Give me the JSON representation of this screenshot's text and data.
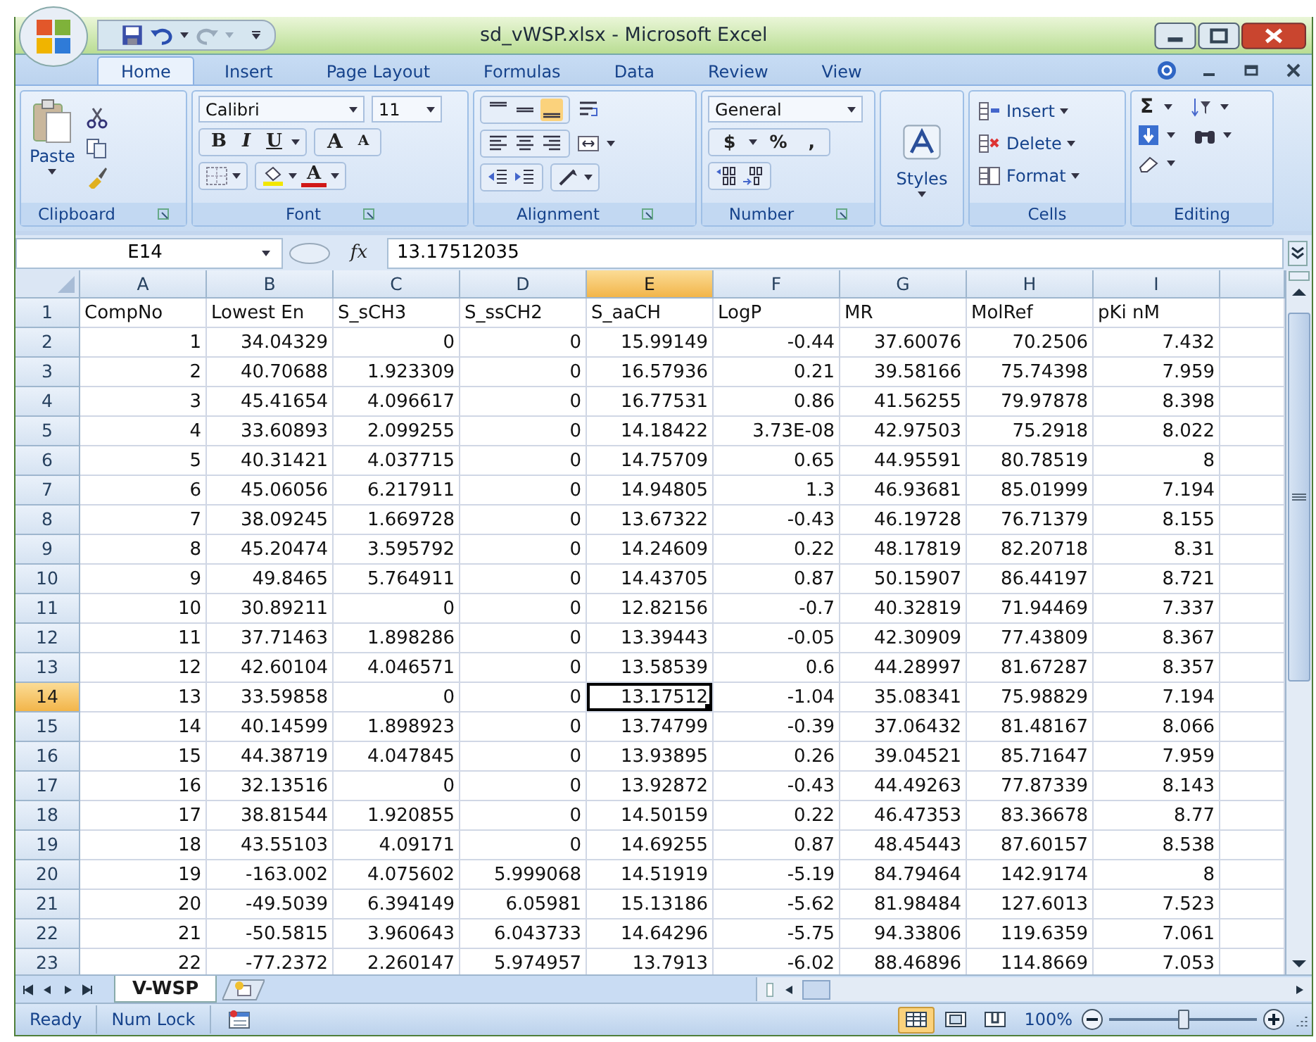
{
  "window": {
    "title": "sd_vWSP.xlsx - Microsoft Excel"
  },
  "tabs": [
    {
      "label": "Home",
      "selected": true
    },
    {
      "label": "Insert",
      "selected": false
    },
    {
      "label": "Page Layout",
      "selected": false
    },
    {
      "label": "Formulas",
      "selected": false
    },
    {
      "label": "Data",
      "selected": false
    },
    {
      "label": "Review",
      "selected": false
    },
    {
      "label": "View",
      "selected": false
    }
  ],
  "ribbon": {
    "groups": [
      {
        "kind": "clipboard",
        "label": "Clipboard",
        "button": "Paste"
      },
      {
        "kind": "font",
        "label": "Font",
        "font_name": "Calibri",
        "font_size": "11",
        "styles": [
          "B",
          "I",
          "U"
        ],
        "grow": "A",
        "shrink": "A",
        "color_letter": "A"
      },
      {
        "kind": "alignment",
        "label": "Alignment"
      },
      {
        "kind": "number",
        "label": "Number",
        "format": "General",
        "symbols": [
          "$",
          "%",
          ","
        ]
      },
      {
        "kind": "styles",
        "button": "Styles"
      },
      {
        "kind": "cells",
        "label": "Cells",
        "items": [
          "Insert",
          "Delete",
          "Format"
        ]
      },
      {
        "kind": "editing",
        "label": "Editing",
        "sigma": "Σ"
      }
    ]
  },
  "formula_bar": {
    "name_box": "E14",
    "fx": "fx",
    "value": "13.17512035"
  },
  "columns": [
    {
      "label": "A",
      "selected": false
    },
    {
      "label": "B",
      "selected": false
    },
    {
      "label": "C",
      "selected": false
    },
    {
      "label": "D",
      "selected": false
    },
    {
      "label": "E",
      "selected": true
    },
    {
      "label": "F",
      "selected": false
    },
    {
      "label": "G",
      "selected": false
    },
    {
      "label": "H",
      "selected": false
    },
    {
      "label": "I",
      "selected": false
    }
  ],
  "rows": [
    {
      "num": "1",
      "kind": "header",
      "selected": false,
      "cells": [
        "CompNo",
        "Lowest En",
        "S_sCH3",
        "S_ssCH2",
        "S_aaCH",
        "LogP",
        "MR",
        "MolRef",
        "pKi nM"
      ]
    },
    {
      "num": "2",
      "kind": "data",
      "selected": false,
      "cells": [
        "1",
        "34.04329",
        "0",
        "0",
        "15.99149",
        "-0.44",
        "37.60076",
        "70.2506",
        "7.432"
      ]
    },
    {
      "num": "3",
      "kind": "data",
      "selected": false,
      "cells": [
        "2",
        "40.70688",
        "1.923309",
        "0",
        "16.57936",
        "0.21",
        "39.58166",
        "75.74398",
        "7.959"
      ]
    },
    {
      "num": "4",
      "kind": "data",
      "selected": false,
      "cells": [
        "3",
        "45.41654",
        "4.096617",
        "0",
        "16.77531",
        "0.86",
        "41.56255",
        "79.97878",
        "8.398"
      ]
    },
    {
      "num": "5",
      "kind": "data",
      "selected": false,
      "cells": [
        "4",
        "33.60893",
        "2.099255",
        "0",
        "14.18422",
        "3.73E-08",
        "42.97503",
        "75.2918",
        "8.022"
      ]
    },
    {
      "num": "6",
      "kind": "data",
      "selected": false,
      "cells": [
        "5",
        "40.31421",
        "4.037715",
        "0",
        "14.75709",
        "0.65",
        "44.95591",
        "80.78519",
        "8"
      ]
    },
    {
      "num": "7",
      "kind": "data",
      "selected": false,
      "cells": [
        "6",
        "45.06056",
        "6.217911",
        "0",
        "14.94805",
        "1.3",
        "46.93681",
        "85.01999",
        "7.194"
      ]
    },
    {
      "num": "8",
      "kind": "data",
      "selected": false,
      "cells": [
        "7",
        "38.09245",
        "1.669728",
        "0",
        "13.67322",
        "-0.43",
        "46.19728",
        "76.71379",
        "8.155"
      ]
    },
    {
      "num": "9",
      "kind": "data",
      "selected": false,
      "cells": [
        "8",
        "45.20474",
        "3.595792",
        "0",
        "14.24609",
        "0.22",
        "48.17819",
        "82.20718",
        "8.31"
      ]
    },
    {
      "num": "10",
      "kind": "data",
      "selected": false,
      "cells": [
        "9",
        "49.8465",
        "5.764911",
        "0",
        "14.43705",
        "0.87",
        "50.15907",
        "86.44197",
        "8.721"
      ]
    },
    {
      "num": "11",
      "kind": "data",
      "selected": false,
      "cells": [
        "10",
        "30.89211",
        "0",
        "0",
        "12.82156",
        "-0.7",
        "40.32819",
        "71.94469",
        "7.337"
      ]
    },
    {
      "num": "12",
      "kind": "data",
      "selected": false,
      "cells": [
        "11",
        "37.71463",
        "1.898286",
        "0",
        "13.39443",
        "-0.05",
        "42.30909",
        "77.43809",
        "8.367"
      ]
    },
    {
      "num": "13",
      "kind": "data",
      "selected": false,
      "cells": [
        "12",
        "42.60104",
        "4.046571",
        "0",
        "13.58539",
        "0.6",
        "44.28997",
        "81.67287",
        "8.357"
      ]
    },
    {
      "num": "14",
      "kind": "data",
      "selected": true,
      "cells": [
        "13",
        "33.59858",
        "0",
        "0",
        "13.17512",
        "-1.04",
        "35.08341",
        "75.98829",
        "7.194"
      ]
    },
    {
      "num": "15",
      "kind": "data",
      "selected": false,
      "cells": [
        "14",
        "40.14599",
        "1.898923",
        "0",
        "13.74799",
        "-0.39",
        "37.06432",
        "81.48167",
        "8.066"
      ]
    },
    {
      "num": "16",
      "kind": "data",
      "selected": false,
      "cells": [
        "15",
        "44.38719",
        "4.047845",
        "0",
        "13.93895",
        "0.26",
        "39.04521",
        "85.71647",
        "7.959"
      ]
    },
    {
      "num": "17",
      "kind": "data",
      "selected": false,
      "cells": [
        "16",
        "32.13516",
        "0",
        "0",
        "13.92872",
        "-0.43",
        "44.49263",
        "77.87339",
        "8.143"
      ]
    },
    {
      "num": "18",
      "kind": "data",
      "selected": false,
      "cells": [
        "17",
        "38.81544",
        "1.920855",
        "0",
        "14.50159",
        "0.22",
        "46.47353",
        "83.36678",
        "8.77"
      ]
    },
    {
      "num": "19",
      "kind": "data",
      "selected": false,
      "cells": [
        "18",
        "43.55103",
        "4.09171",
        "0",
        "14.69255",
        "0.87",
        "48.45443",
        "87.60157",
        "8.538"
      ]
    },
    {
      "num": "20",
      "kind": "data",
      "selected": false,
      "cells": [
        "19",
        "-163.002",
        "4.075602",
        "5.999068",
        "14.51919",
        "-5.19",
        "84.79464",
        "142.9174",
        "8"
      ]
    },
    {
      "num": "21",
      "kind": "data",
      "selected": false,
      "cells": [
        "20",
        "-49.5039",
        "6.394149",
        "6.05981",
        "15.13186",
        "-5.62",
        "81.98484",
        "127.6013",
        "7.523"
      ]
    },
    {
      "num": "22",
      "kind": "data",
      "selected": false,
      "cells": [
        "21",
        "-50.5815",
        "3.960643",
        "6.043733",
        "14.64296",
        "-5.75",
        "94.33806",
        "119.6359",
        "7.061"
      ]
    },
    {
      "num": "23",
      "kind": "data",
      "selected": false,
      "cells": [
        "22",
        "-77.2372",
        "2.260147",
        "5.974957",
        "13.7913",
        "-6.02",
        "88.46896",
        "114.8669",
        "7.053"
      ]
    }
  ],
  "sheet_tabs": [
    {
      "label": "V-WSP",
      "selected": true
    }
  ],
  "status_bar": {
    "mode": "Ready",
    "num_lock": "Num Lock",
    "views": [
      {
        "kind": "normal",
        "selected": true
      },
      {
        "kind": "page-layout",
        "selected": false
      },
      {
        "kind": "page-break",
        "selected": false
      }
    ],
    "zoom": {
      "label": "100%",
      "level": 0.5
    }
  }
}
